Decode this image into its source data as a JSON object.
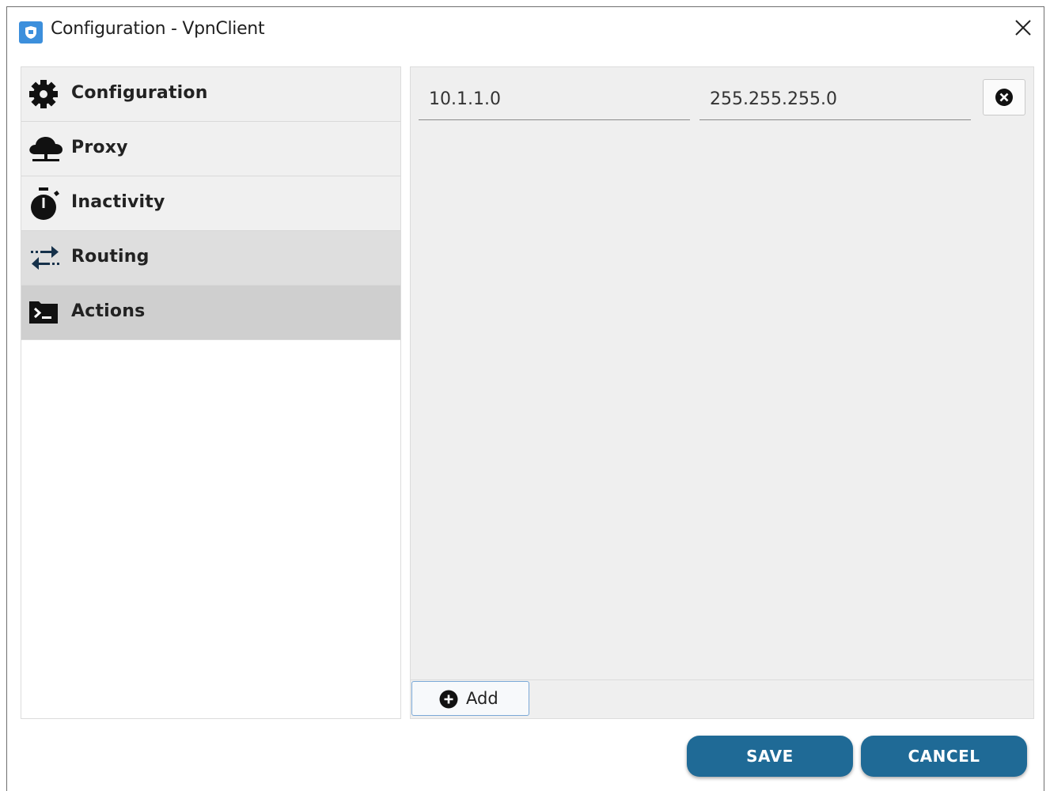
{
  "window": {
    "title": "Configuration - VpnClient",
    "app_icon": "shield-icon",
    "close_icon": "close-icon"
  },
  "sidebar": {
    "items": [
      {
        "label": "Configuration",
        "icon": "gear-icon",
        "state": "normal"
      },
      {
        "label": "Proxy",
        "icon": "cloud-icon",
        "state": "normal"
      },
      {
        "label": "Inactivity",
        "icon": "stopwatch-icon",
        "state": "normal"
      },
      {
        "label": "Routing",
        "icon": "swap-arrows-icon",
        "state": "hover"
      },
      {
        "label": "Actions",
        "icon": "terminal-icon",
        "state": "selected"
      }
    ]
  },
  "routes": [
    {
      "network": "10.1.1.0",
      "mask": "255.255.255.0"
    }
  ],
  "content": {
    "add_label": "Add"
  },
  "footer": {
    "save_label": "SAVE",
    "cancel_label": "CANCEL"
  },
  "colors": {
    "accent": "#1f6a96",
    "app_icon": "#3c8fdc",
    "selected_item": "#cfcfcf",
    "hover_item": "#dedede",
    "content_bg": "#efefef"
  }
}
